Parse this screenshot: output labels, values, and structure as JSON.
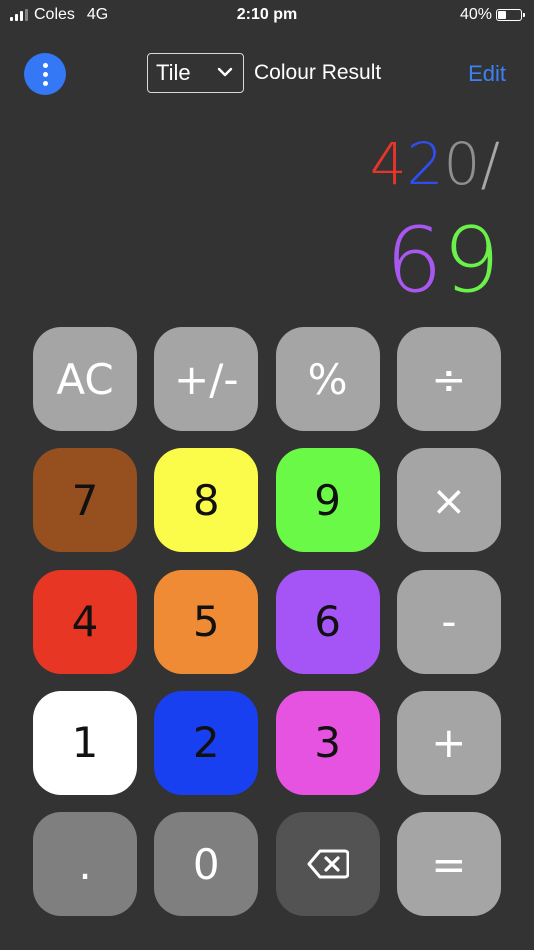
{
  "status": {
    "carrier": "Coles",
    "network": "4G",
    "time": "2:10 pm",
    "battery": "40%",
    "battery_level": 0.4
  },
  "nav": {
    "mode_value": "Tile",
    "title": "Colour Result",
    "edit_label": "Edit",
    "menu_icon": "more-vertical-icon"
  },
  "display": {
    "expression": [
      {
        "char": "4",
        "color": "#e8352a"
      },
      {
        "char": "2",
        "color": "#2f4ef0"
      },
      {
        "char": "0",
        "color": "#8f8f8f"
      },
      {
        "char": "/",
        "color": "#a8a8a8"
      }
    ],
    "result": [
      {
        "char": "6",
        "color": "#a858f0"
      },
      {
        "char": "9",
        "color": "#6af24a"
      }
    ]
  },
  "keys": [
    {
      "id": "ac",
      "label": "AC",
      "bg": "#a5a5a5",
      "fg": "#ffffff"
    },
    {
      "id": "plus-minus",
      "label": "+/-",
      "bg": "#a5a5a5",
      "fg": "#ffffff"
    },
    {
      "id": "percent",
      "label": "%",
      "bg": "#a5a5a5",
      "fg": "#ffffff"
    },
    {
      "id": "divide",
      "label": "÷",
      "bg": "#a5a5a5",
      "fg": "#ffffff"
    },
    {
      "id": "7",
      "label": "7",
      "bg": "#964f1f",
      "fg": "#111111"
    },
    {
      "id": "8",
      "label": "8",
      "bg": "#fbfc4a",
      "fg": "#111111"
    },
    {
      "id": "9",
      "label": "9",
      "bg": "#6bf947",
      "fg": "#111111"
    },
    {
      "id": "multiply",
      "label": "×",
      "bg": "#a5a5a5",
      "fg": "#ffffff"
    },
    {
      "id": "4",
      "label": "4",
      "bg": "#e73624",
      "fg": "#111111"
    },
    {
      "id": "5",
      "label": "5",
      "bg": "#f08b35",
      "fg": "#111111"
    },
    {
      "id": "6",
      "label": "6",
      "bg": "#a555f5",
      "fg": "#111111"
    },
    {
      "id": "minus",
      "label": "-",
      "bg": "#a5a5a5",
      "fg": "#ffffff"
    },
    {
      "id": "1",
      "label": "1",
      "bg": "#ffffff",
      "fg": "#111111"
    },
    {
      "id": "2",
      "label": "2",
      "bg": "#1940f0",
      "fg": "#111111"
    },
    {
      "id": "3",
      "label": "3",
      "bg": "#e553e0",
      "fg": "#111111"
    },
    {
      "id": "plus",
      "label": "+",
      "bg": "#a5a5a5",
      "fg": "#ffffff"
    },
    {
      "id": "decimal",
      "label": ".",
      "bg": "#7f7f7f",
      "fg": "#ffffff"
    },
    {
      "id": "0",
      "label": "0",
      "bg": "#7f7f7f",
      "fg": "#ffffff"
    },
    {
      "id": "backspace",
      "label": "",
      "icon": "backspace-icon",
      "bg": "#535353",
      "fg": "#ffffff"
    },
    {
      "id": "equals",
      "label": "=",
      "bg": "#a5a5a5",
      "fg": "#ffffff"
    }
  ]
}
